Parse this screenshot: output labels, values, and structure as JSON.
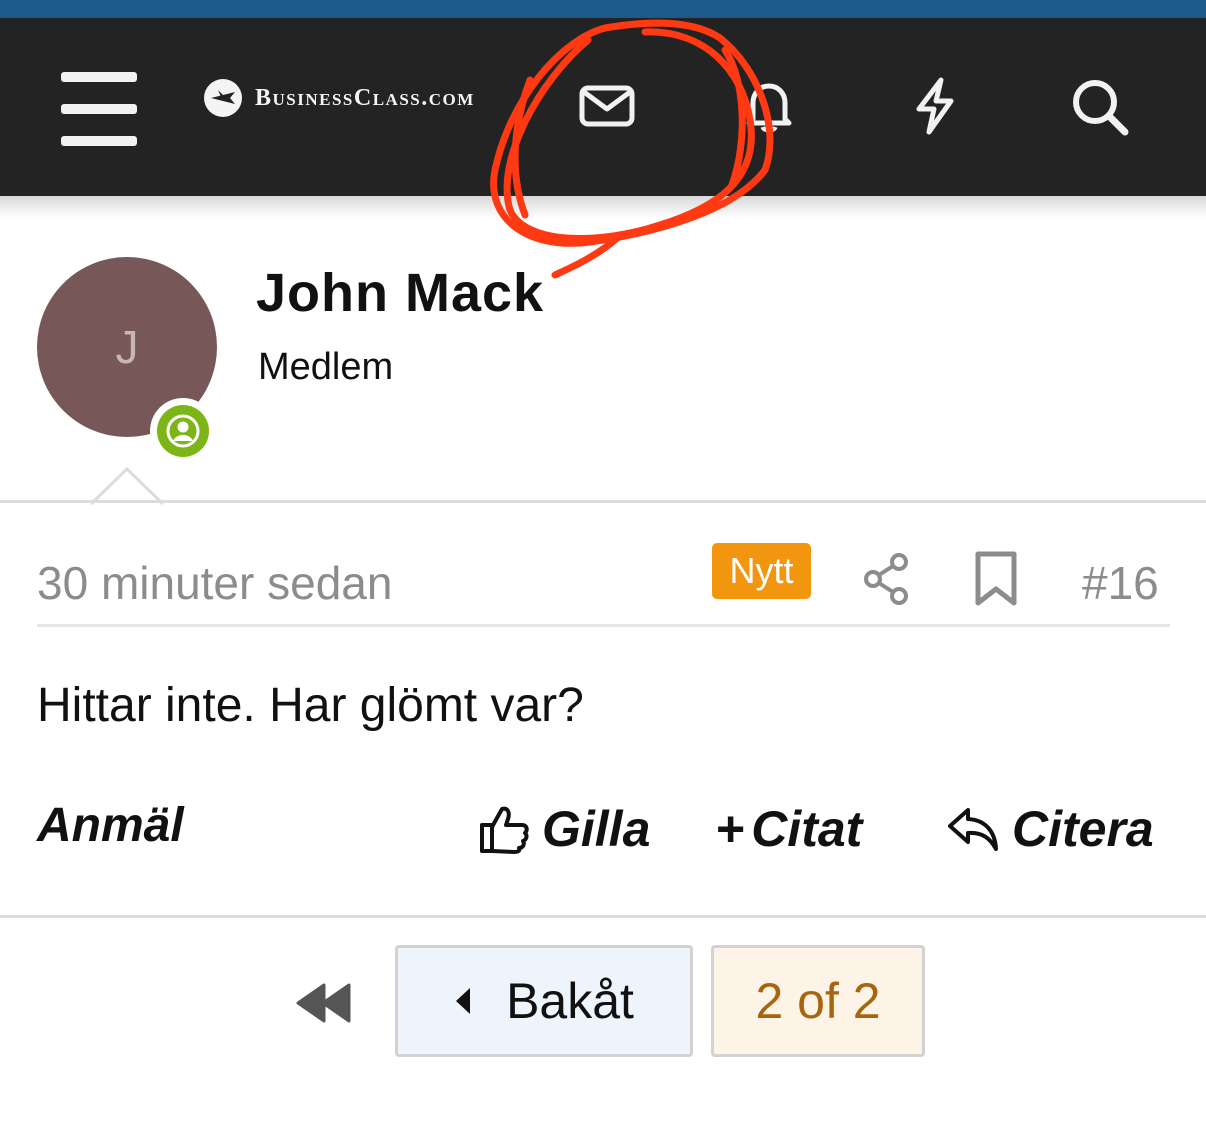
{
  "header": {
    "logo_text": "BusinessClass.com",
    "icons": [
      "menu-icon",
      "envelope-icon",
      "bell-icon",
      "lightning-icon",
      "search-icon"
    ],
    "colors": {
      "navbar": "#232323",
      "topstrip": "#1c5a8c",
      "annotation": "#ff3a12"
    }
  },
  "post": {
    "avatar_initial": "J",
    "author": "John Mack",
    "author_title": "Medlem",
    "time": "30 minuter sedan",
    "badge": "Nytt",
    "number": "#16",
    "message": "Hittar inte. Har glömt var?",
    "actions": {
      "report": "Anmäl",
      "like": "Gilla",
      "plus": "+",
      "multiquote": "Citat",
      "reply": "Citera"
    }
  },
  "pagination": {
    "back_label": "Bakåt",
    "page_indicator": "2 of 2"
  }
}
